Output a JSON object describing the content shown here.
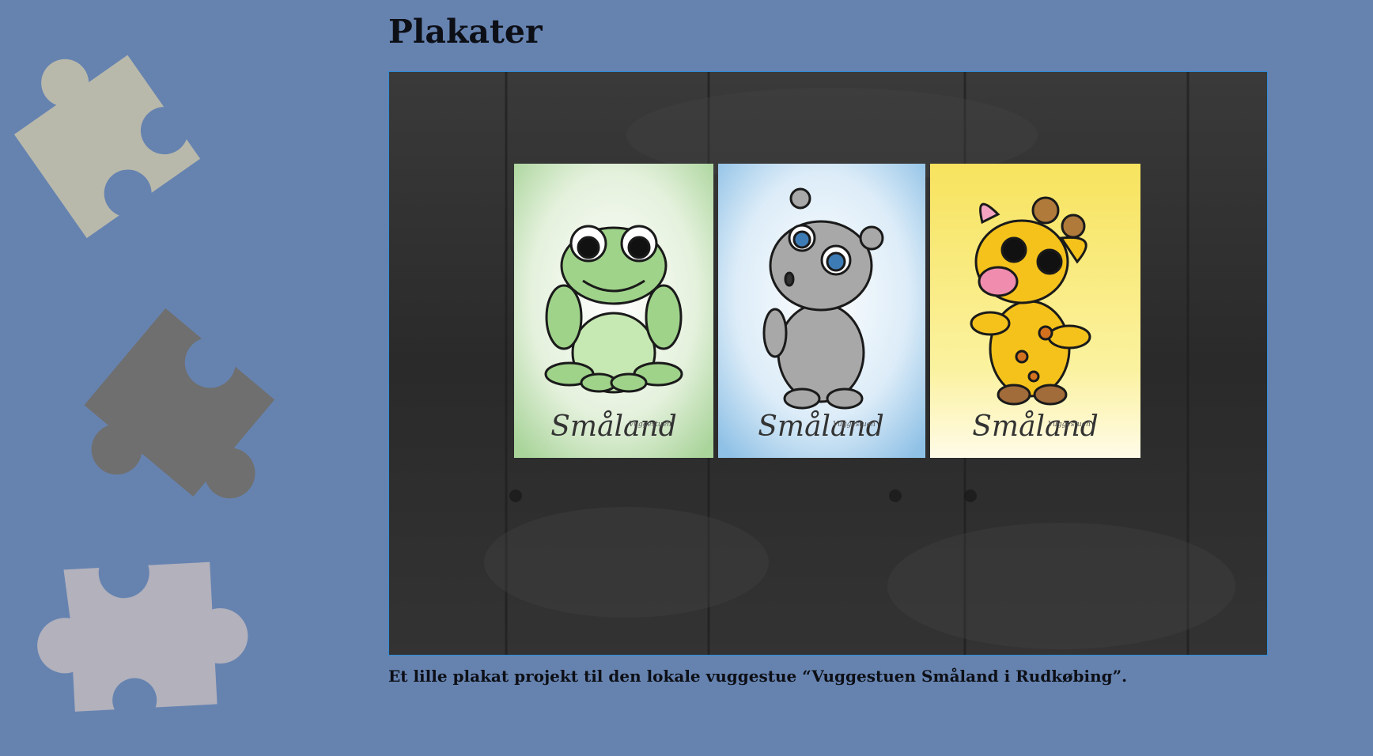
{
  "page": {
    "title": "Plakater",
    "caption": "Et lille plakat projekt til den lokale vuggestue “Vuggestuen Småland i Rudkøbing”."
  },
  "photo": {
    "posters": [
      {
        "animal": "frog",
        "label": "Småland",
        "sublabel": "Vuggestuen"
      },
      {
        "animal": "hippo",
        "label": "Småland",
        "sublabel": "Vuggestuen"
      },
      {
        "animal": "giraffe",
        "label": "Småland",
        "sublabel": "Vuggestuen"
      }
    ]
  },
  "colors": {
    "background": "#6683b0",
    "frame_border": "#2f8cd8",
    "puzzle_beige": "#b9b9ab",
    "puzzle_dark": "#6f6f6f",
    "puzzle_light": "#b2b1bc"
  }
}
